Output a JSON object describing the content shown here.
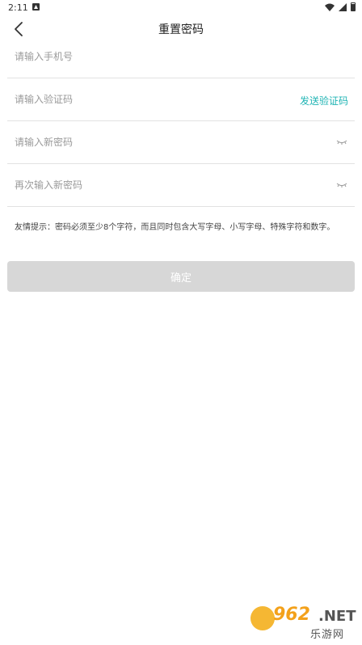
{
  "status_bar": {
    "time": "2:11",
    "icons": [
      "notification-icon",
      "wifi-icon",
      "signal-icon",
      "battery-icon"
    ]
  },
  "header": {
    "back_icon": "chevron-left-icon",
    "title": "重置密码"
  },
  "form": {
    "phone_placeholder": "请输入手机号",
    "code_placeholder": "请输入验证码",
    "send_code_label": "发送验证码",
    "new_password_placeholder": "请输入新密码",
    "confirm_password_placeholder": "再次输入新密码",
    "eye_icon": "eye-closed-icon"
  },
  "tip": "友情提示：密码必须至少8个字符，而且同时包含大写字母、小写字母、特殊字符和数字。",
  "confirm_label": "确定",
  "watermark": {
    "number": "962",
    "suffix": ".NET",
    "cn_text": "乐游网"
  },
  "colors": {
    "accent": "#1fb4b4",
    "button_disabled": "#d7d7d7",
    "divider": "#e2e2e2",
    "placeholder": "#9a9a9a"
  }
}
